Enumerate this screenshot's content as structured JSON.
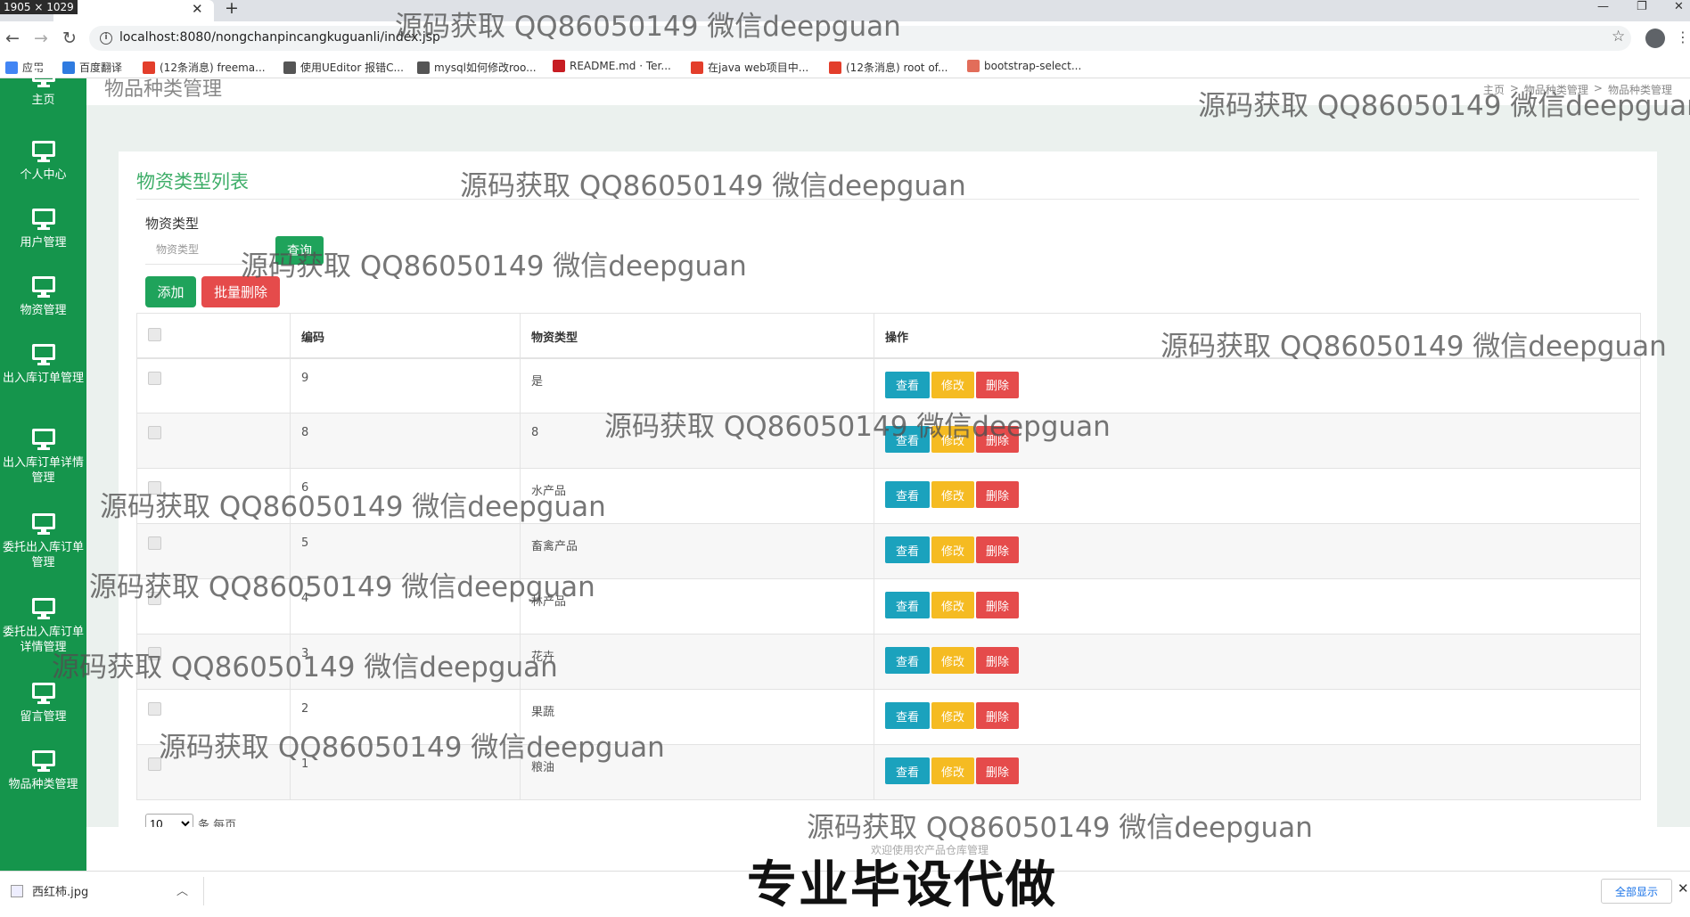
{
  "browser": {
    "dimension_badge": "1905 × 1029",
    "url": "localhost:8080/nongchanpincangkuguanli/index.jsp",
    "bookmarks": [
      {
        "label": "应用",
        "icon": "apps-grid-icon",
        "color": "#4285f4"
      },
      {
        "label": "百度翻译",
        "icon": "baidu-translate-icon",
        "color": "#2f7be0"
      },
      {
        "label": "(12条消息) freema...",
        "icon": "csdn-icon",
        "color": "#e33e2b"
      },
      {
        "label": "使用UEditor 报错C...",
        "icon": "bird-icon",
        "color": "#555555"
      },
      {
        "label": "mysql如何修改roo...",
        "icon": "bird-icon",
        "color": "#555555"
      },
      {
        "label": "README.md · Ter...",
        "icon": "gitee-icon",
        "color": "#c71d23"
      },
      {
        "label": "在java web项目中...",
        "icon": "csdn-icon",
        "color": "#e33e2b"
      },
      {
        "label": "(12条消息) root of...",
        "icon": "csdn-icon",
        "color": "#e33e2b"
      },
      {
        "label": "bootstrap-select...",
        "icon": "jianshu-icon",
        "color": "#e26d5a"
      }
    ]
  },
  "sidebar": {
    "items": [
      {
        "label": "主页"
      },
      {
        "label": "个人中心"
      },
      {
        "label": "用户管理"
      },
      {
        "label": "物资管理"
      },
      {
        "label": "出入库订单管理"
      },
      {
        "label": "出入库订单详情管理"
      },
      {
        "label": "委托出入库订单管理"
      },
      {
        "label": "委托出入库订单详情管理"
      },
      {
        "label": "留言管理"
      },
      {
        "label": "物品种类管理"
      }
    ]
  },
  "header": {
    "page_title": "物品种类管理",
    "breadcrumb": [
      "主页",
      ">",
      "物品种类管理",
      ">",
      "物品种类管理"
    ]
  },
  "panel": {
    "title": "物资类型列表",
    "search_label": "物资类型",
    "search_placeholder": "物资类型",
    "search_button": "查询",
    "add_button": "添加",
    "batch_delete_button": "批量删除"
  },
  "table": {
    "columns": [
      "",
      "编码",
      "物资类型",
      "操作"
    ],
    "rows": [
      {
        "code": "9",
        "type": "是"
      },
      {
        "code": "8",
        "type": "8"
      },
      {
        "code": "6",
        "type": "水产品"
      },
      {
        "code": "5",
        "type": "畜禽产品"
      },
      {
        "code": "4",
        "type": "林产品"
      },
      {
        "code": "3",
        "type": "花卉"
      },
      {
        "code": "2",
        "type": "果蔬"
      },
      {
        "code": "1",
        "type": "粮油"
      }
    ],
    "actions": {
      "view": "查看",
      "edit": "修改",
      "delete": "删除"
    }
  },
  "pagination": {
    "page_size": "10",
    "page_size_label": "条 每页"
  },
  "footer": {
    "text": "欢迎使用农产品仓库管理"
  },
  "downloads": {
    "file_name": "西红柿.jpg",
    "show_all": "全部显示"
  },
  "overlay": {
    "watermark": "源码获取 QQ86050149 微信deepguan",
    "promo": "专业毕设代做"
  },
  "colors": {
    "sidebar": "#15954c",
    "accent_green": "#1fa35b",
    "danger": "#e54b4b",
    "info": "#1ba2bd",
    "warning": "#f5bb22"
  }
}
